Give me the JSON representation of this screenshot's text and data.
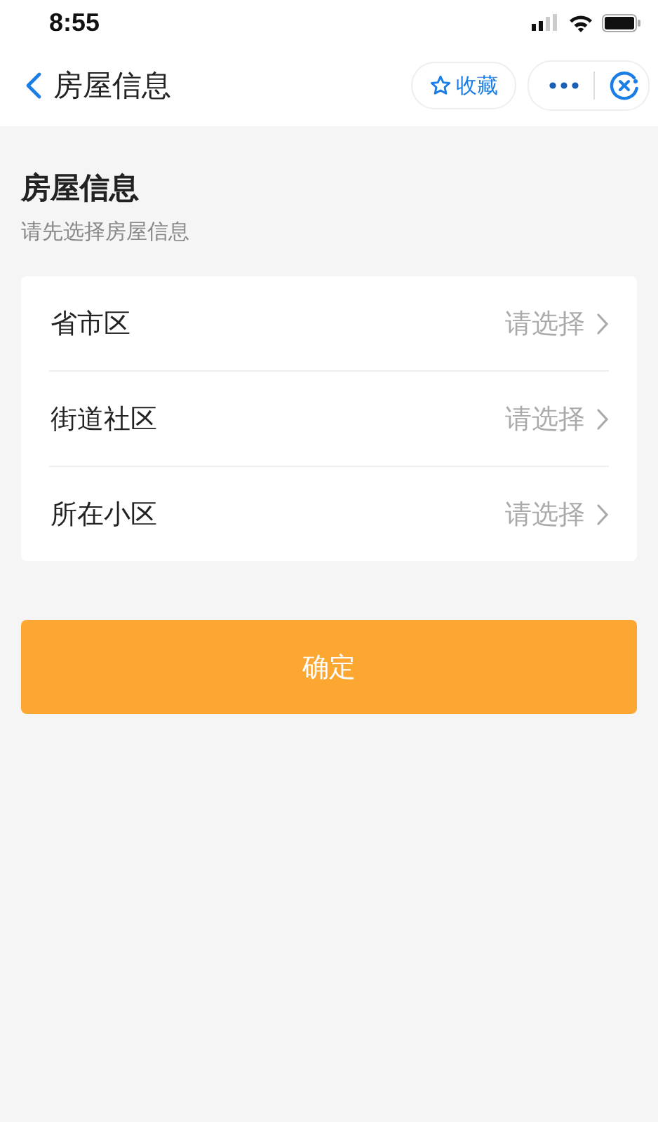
{
  "status_bar": {
    "time": "8:55"
  },
  "nav_bar": {
    "title": "房屋信息",
    "favorite_label": "收藏"
  },
  "section": {
    "title": "房屋信息",
    "subtitle": "请先选择房屋信息"
  },
  "fields": [
    {
      "label": "省市区",
      "placeholder": "请选择"
    },
    {
      "label": "街道社区",
      "placeholder": "请选择"
    },
    {
      "label": "所在小区",
      "placeholder": "请选择"
    }
  ],
  "confirm_button": "确定"
}
